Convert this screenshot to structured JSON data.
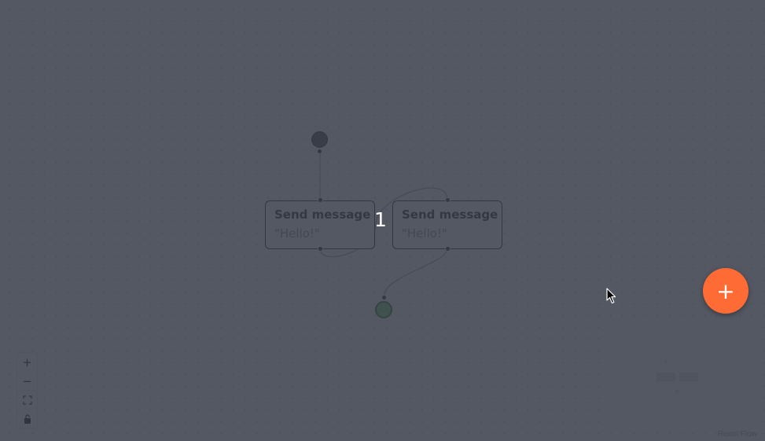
{
  "nodes": [
    {
      "title": "Send message",
      "body": "\"Hello!\""
    },
    {
      "title": "Send message",
      "body": "\"Hello!\""
    }
  ],
  "selection_count": "1",
  "controls": {
    "zoom_in": "+",
    "zoom_out": "−",
    "fit_view_icon": "fit-view-icon",
    "lock_icon": "lock-icon"
  },
  "fab_label": "+",
  "attribution": "React Flow",
  "colors": {
    "overlay": "#383c48",
    "fab": "#ff6b35",
    "end_node": "#6ad36a",
    "start_node": "#3b3f4a"
  }
}
